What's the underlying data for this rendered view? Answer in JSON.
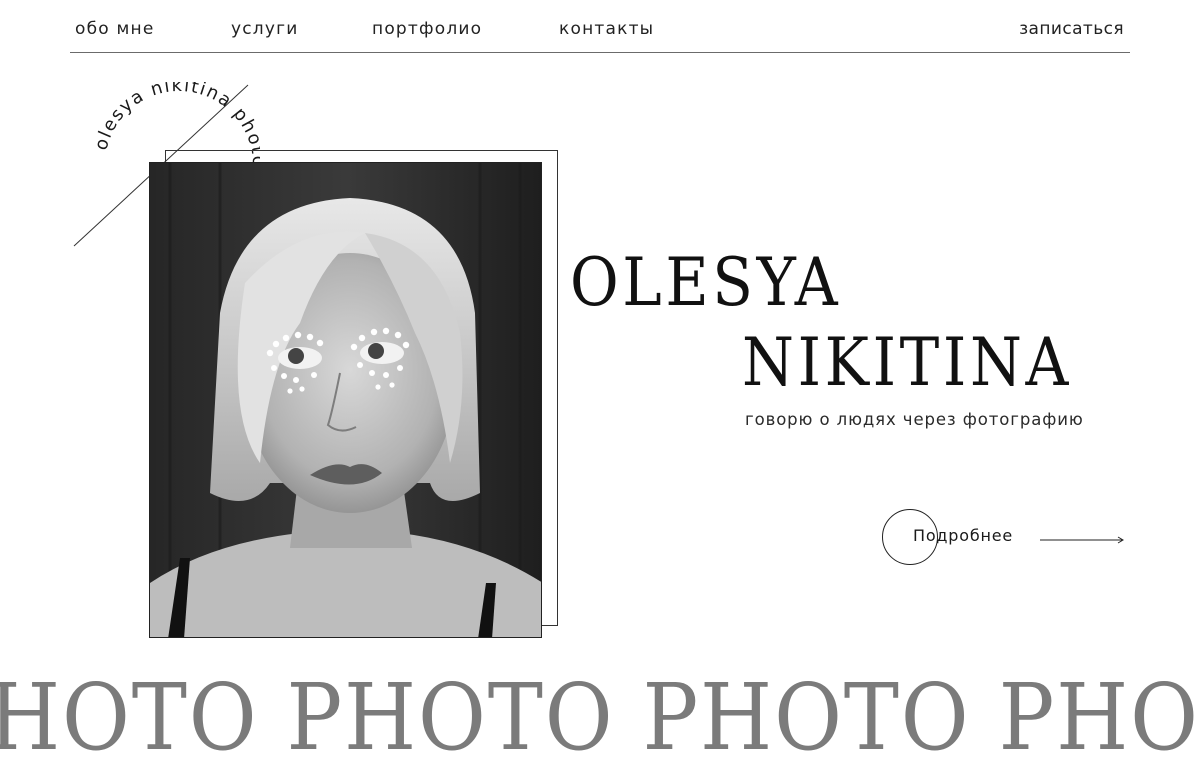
{
  "nav": {
    "items": [
      {
        "label": "обо мне"
      },
      {
        "label": "услуги"
      },
      {
        "label": "портфолио"
      },
      {
        "label": "контакты"
      }
    ],
    "cta_label": "записаться"
  },
  "badge": {
    "text": "olesya nikitina photographer"
  },
  "hero": {
    "name_line1": "OLESYA",
    "name_line2": "NIKITINA",
    "tagline": "говорю о людях через фотографию",
    "more_label": "Подробнее"
  },
  "marquee": {
    "text": "HOTO PHOTO PHOTO PHOT"
  }
}
